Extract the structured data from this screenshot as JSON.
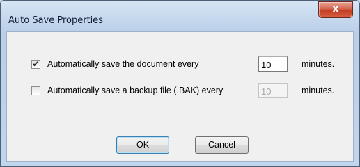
{
  "window": {
    "title": "Auto Save Properties",
    "close_label": "x"
  },
  "options": [
    {
      "checked": true,
      "check_glyph": "✔",
      "label": "Automatically save the document every",
      "value": "10",
      "enabled": true,
      "unit": "minutes."
    },
    {
      "checked": false,
      "check_glyph": "",
      "label": "Automatically save a backup file (.BAK) every",
      "value": "10",
      "enabled": false,
      "unit": "minutes."
    }
  ],
  "buttons": {
    "ok_label": "OK",
    "cancel_label": "Cancel"
  },
  "colors": {
    "close_button": "#c43e26",
    "client_background": "#f0f0f0",
    "default_button_border": "#3c7fb1"
  }
}
